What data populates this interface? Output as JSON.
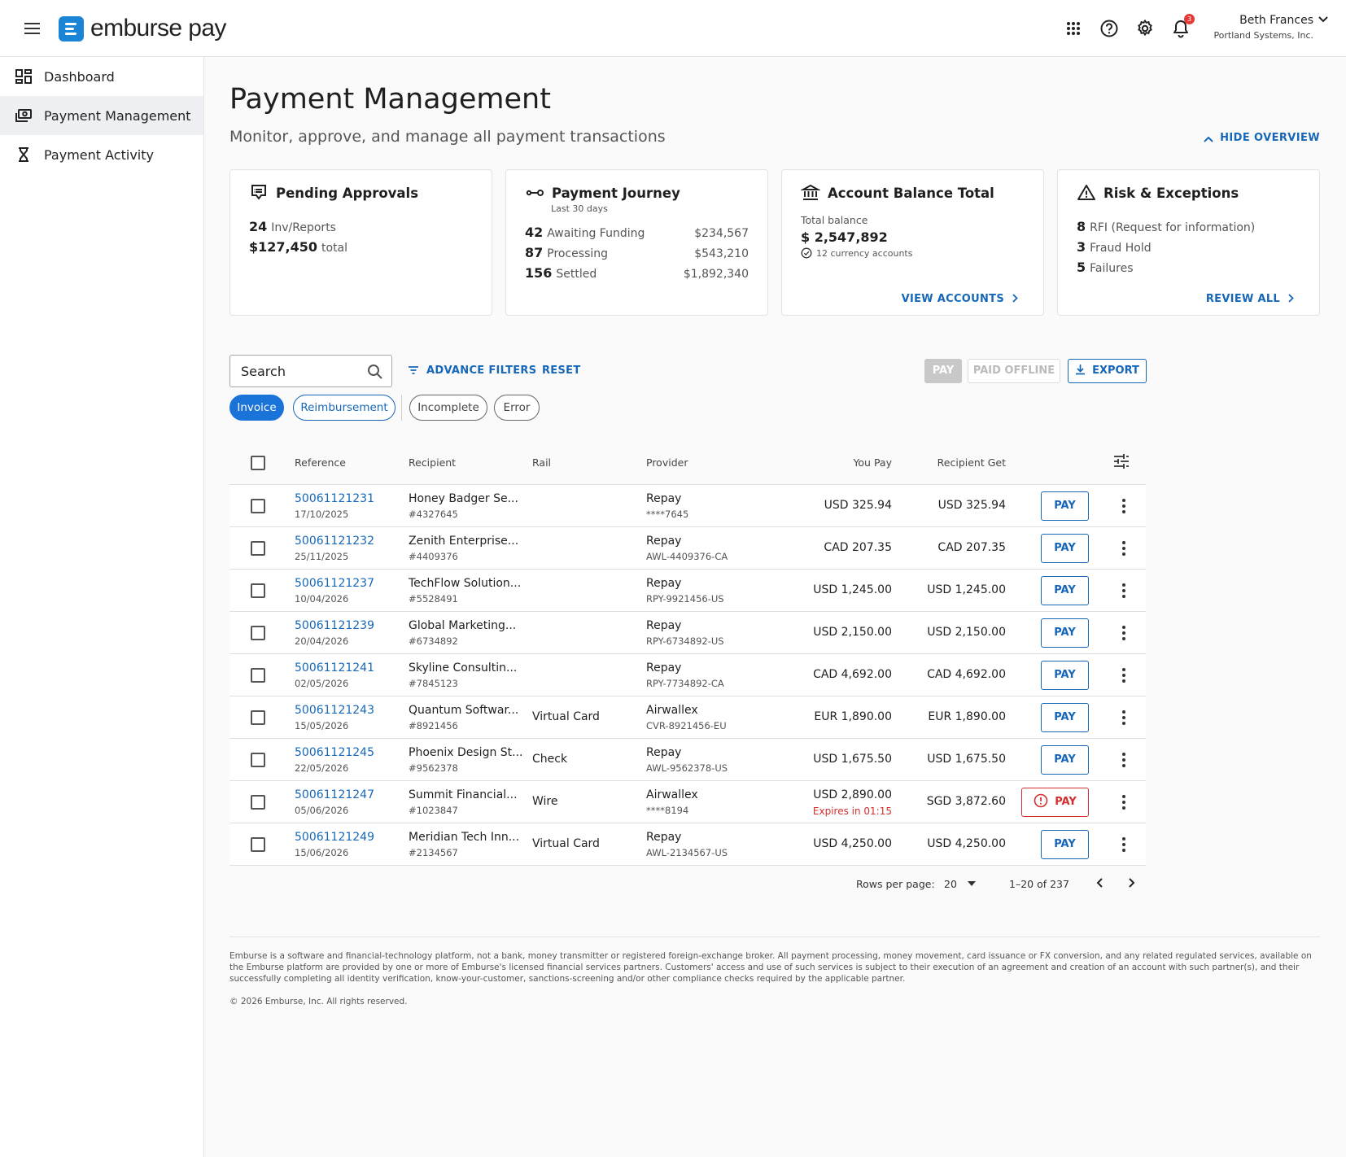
{
  "app": {
    "brand": "emburse pay"
  },
  "user": {
    "name": "Beth Frances",
    "company": "Portland Systems, Inc.",
    "notification_count": "3"
  },
  "sidebar": {
    "items": [
      {
        "label": "Dashboard",
        "icon": "dashboard-icon"
      },
      {
        "label": "Payment Management",
        "icon": "payments-icon",
        "active": true
      },
      {
        "label": "Payment Activity",
        "icon": "hourglass-icon"
      }
    ]
  },
  "header": {
    "title": "Payment Management",
    "subtitle": "Monitor, approve, and manage all payment transactions",
    "toggle_label": "HIDE OVERVIEW"
  },
  "cards": {
    "pending": {
      "title": "Pending Approvals",
      "count": "24",
      "count_label": "Inv/Reports",
      "total": "$127,450",
      "total_label": "total"
    },
    "journey": {
      "title": "Payment Journey",
      "subtitle": "Last 30 days",
      "rows": [
        {
          "count": "42",
          "label": "Awaiting Funding",
          "amount": "$234,567"
        },
        {
          "count": "87",
          "label": "Processing",
          "amount": "$543,210"
        },
        {
          "count": "156",
          "label": "Settled",
          "amount": "$1,892,340"
        }
      ]
    },
    "balance": {
      "title": "Account Balance Total",
      "label": "Total balance",
      "amount": "$ 2,547,892",
      "accounts": "12 currency accounts",
      "link": "VIEW ACCOUNTS"
    },
    "risk": {
      "title": "Risk & Exceptions",
      "rows": [
        {
          "count": "8",
          "label": "RFI (Request for information)"
        },
        {
          "count": "3",
          "label": "Fraud Hold"
        },
        {
          "count": "5",
          "label": "Failures"
        }
      ],
      "link": "REVIEW ALL"
    }
  },
  "toolbar": {
    "search_placeholder": "Search",
    "advance_filters": "ADVANCE FILTERS",
    "reset": "RESET",
    "pay": "PAY",
    "paid_offline": "PAID OFFLINE",
    "export": "EXPORT"
  },
  "chips": [
    {
      "label": "Invoice",
      "state": "selected"
    },
    {
      "label": "Reimbursement",
      "state": "outlined-blue"
    },
    {
      "label": "Incomplete",
      "state": "outlined"
    },
    {
      "label": "Error",
      "state": "outlined"
    }
  ],
  "table": {
    "headers": {
      "reference": "Reference",
      "recipient": "Recipient",
      "rail": "Rail",
      "provider": "Provider",
      "you_pay": "You Pay",
      "recipient_get": "Recipient Get"
    },
    "pay_label": "PAY",
    "rows": [
      {
        "ref": "50061121231",
        "date": "17/10/2025",
        "recipient": "Honey Badger Se...",
        "recipient_id": "#4327645",
        "rail": "",
        "provider": "Repay",
        "provider_acct": "****7645",
        "you_pay": "USD 325.94",
        "recipient_get": "USD 325.94"
      },
      {
        "ref": "50061121232",
        "date": "25/11/2025",
        "recipient": "Zenith Enterprise...",
        "recipient_id": "#4409376",
        "rail": "",
        "provider": "Repay",
        "provider_acct": "AWL-4409376-CA",
        "you_pay": "CAD 207.35",
        "recipient_get": "CAD 207.35"
      },
      {
        "ref": "50061121237",
        "date": "10/04/2026",
        "recipient": "TechFlow Solution...",
        "recipient_id": "#5528491",
        "rail": "",
        "provider": "Repay",
        "provider_acct": "RPY-9921456-US",
        "you_pay": "USD 1,245.00",
        "recipient_get": "USD 1,245.00"
      },
      {
        "ref": "50061121239",
        "date": "20/04/2026",
        "recipient": "Global Marketing...",
        "recipient_id": "#6734892",
        "rail": "",
        "provider": "Repay",
        "provider_acct": "RPY-6734892-US",
        "you_pay": "USD 2,150.00",
        "recipient_get": "USD 2,150.00"
      },
      {
        "ref": "50061121241",
        "date": "02/05/2026",
        "recipient": "Skyline Consultin...",
        "recipient_id": "#7845123",
        "rail": "",
        "provider": "Repay",
        "provider_acct": "RPY-7734892-CA",
        "you_pay": "CAD 4,692.00",
        "recipient_get": "CAD 4,692.00"
      },
      {
        "ref": "50061121243",
        "date": "15/05/2026",
        "recipient": "Quantum Softwar...",
        "recipient_id": "#8921456",
        "rail": "Virtual Card",
        "provider": "Airwallex",
        "provider_acct": "CVR-8921456-EU",
        "you_pay": "EUR 1,890.00",
        "recipient_get": "EUR 1,890.00"
      },
      {
        "ref": "50061121245",
        "date": "22/05/2026",
        "recipient": "Phoenix Design St...",
        "recipient_id": "#9562378",
        "rail": "Check",
        "provider": "Repay",
        "provider_acct": "AWL-9562378-US",
        "you_pay": "USD 1,675.50",
        "recipient_get": "USD 1,675.50"
      },
      {
        "ref": "50061121247",
        "date": "05/06/2026",
        "recipient": "Summit Financial...",
        "recipient_id": "#1023847",
        "rail": "Wire",
        "provider": "Airwallex",
        "provider_acct": "****8194",
        "you_pay": "USD 2,890.00",
        "expires": "Expires in 01:15",
        "recipient_get": "SGD 3,872.60",
        "warning": true
      },
      {
        "ref": "50061121249",
        "date": "15/06/2026",
        "recipient": "Meridian Tech Inn...",
        "recipient_id": "#2134567",
        "rail": "Virtual Card",
        "provider": "Repay",
        "provider_acct": "AWL-2134567-US",
        "you_pay": "USD 4,250.00",
        "recipient_get": "USD 4,250.00"
      }
    ]
  },
  "pagination": {
    "rows_label": "Rows per page:",
    "rows_value": "20",
    "range": "1–20 of 237"
  },
  "footer": {
    "disclaimer": "Emburse is a software and financial-technology platform, not a bank, money transmitter or registered foreign-exchange broker. All payment processing, money movement, card issuance or FX conversion, and any related regulated services, available on the Emburse platform are provided by one or more of Emburse's licensed financial services partners. Customers' access and use of such services is subject to their execution of an agreement and creation of an account with such partner(s), and their successfully completing all identity verification, know-your-customer, sanctions-screening and/or other compliance checks required by the applicable partner.",
    "copyright": "© 2026 Emburse, Inc. All rights reserved."
  },
  "colors": {
    "accent": "#1667b8",
    "brand": "#1a84d6",
    "error": "#d32f2f",
    "chip_selected": "#1a73d9"
  }
}
